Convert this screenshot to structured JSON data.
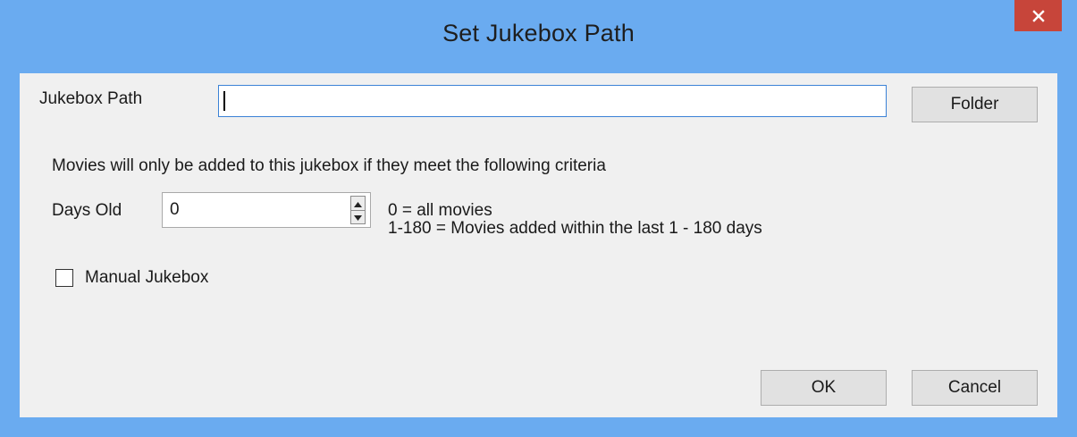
{
  "window": {
    "title": "Set Jukebox Path",
    "close_icon": "close-icon"
  },
  "jukebox_path": {
    "label": "Jukebox Path",
    "value": "",
    "folder_button": "Folder"
  },
  "criteria": {
    "intro": "Movies will only be added to this jukebox if they meet the following criteria",
    "days_old_label": "Days Old",
    "days_old_value": "0",
    "hint_line_1": "0 = all movies",
    "hint_line_2": "1-180 = Movies added within the last 1 - 180 days"
  },
  "manual": {
    "label": "Manual Jukebox",
    "checked": false
  },
  "buttons": {
    "ok": "OK",
    "cancel": "Cancel"
  },
  "colors": {
    "titlebar": "#6aabf0",
    "close": "#c7453a",
    "client": "#f0f0f0"
  }
}
